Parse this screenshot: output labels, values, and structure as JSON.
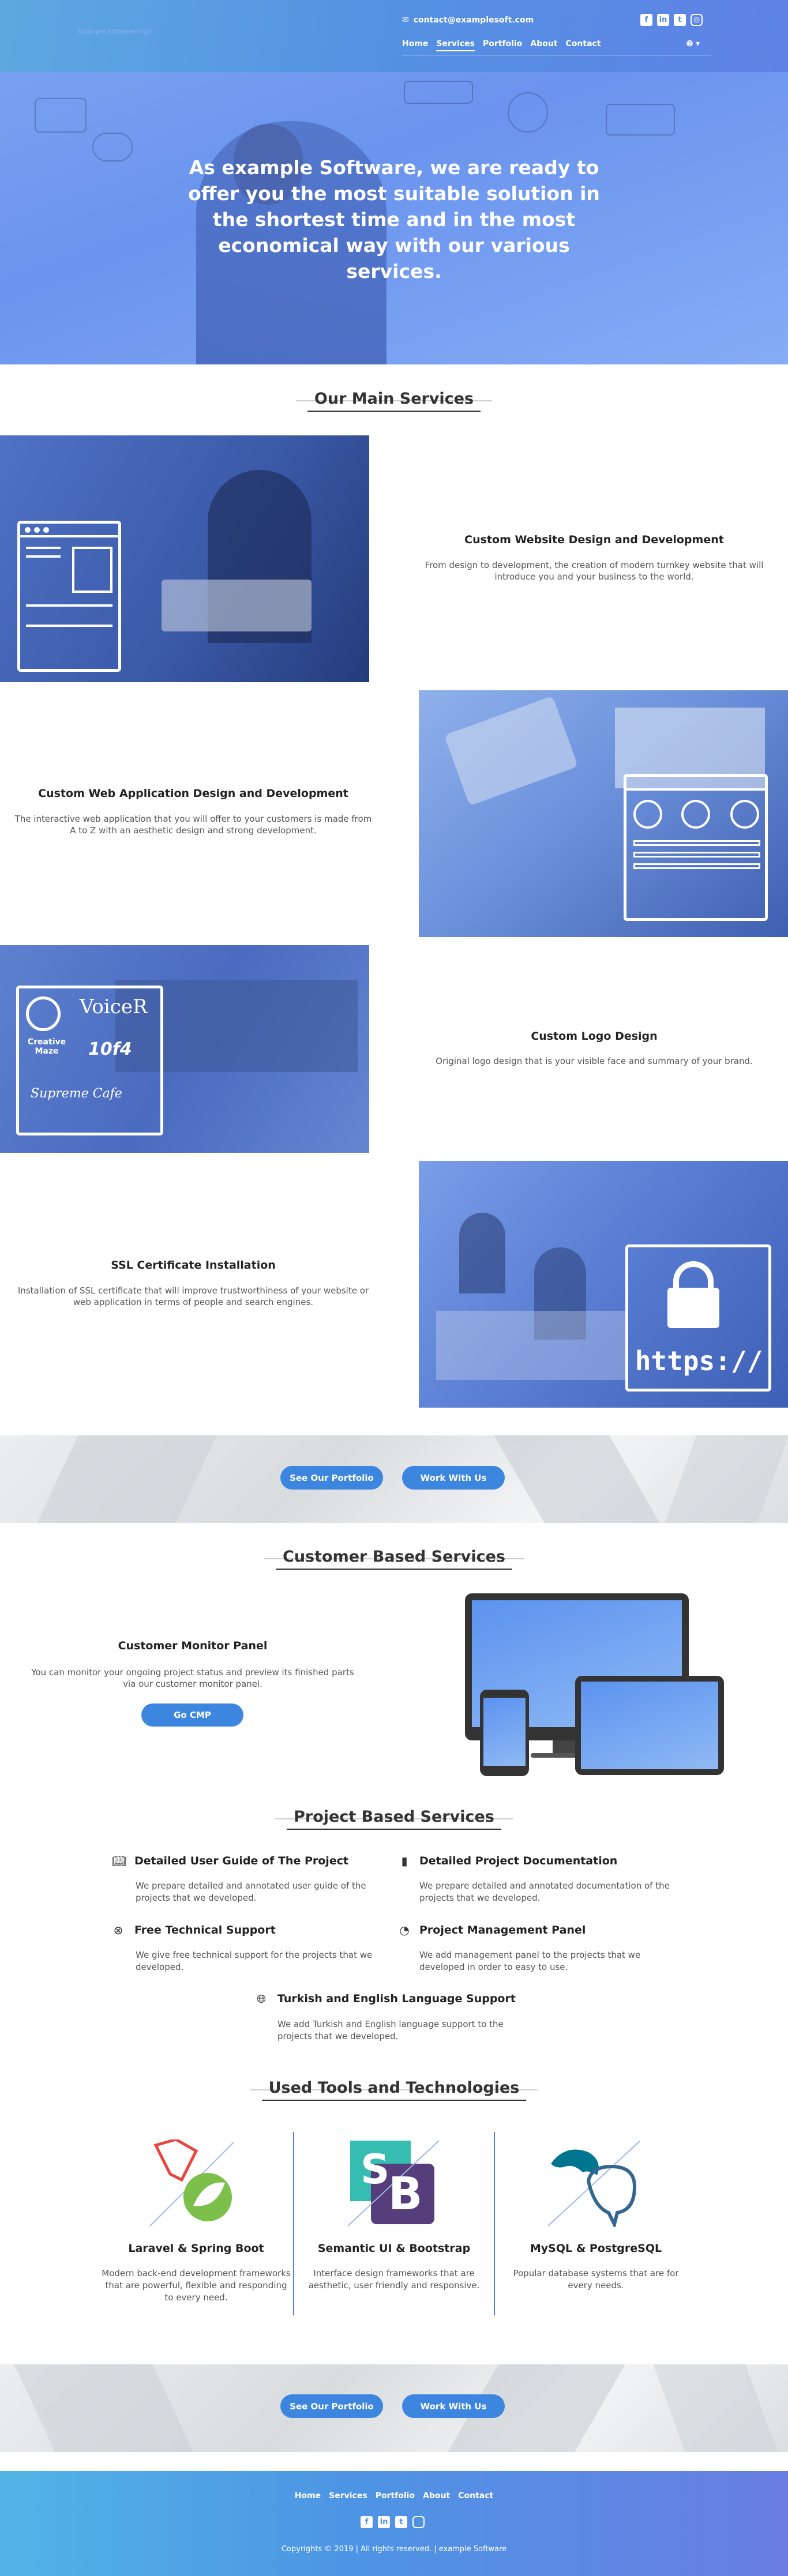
{
  "header": {
    "logo_alt": "Example Software logo",
    "email": "contact@examplesoft.com",
    "nav": [
      "Home",
      "Services",
      "Portfolio",
      "About",
      "Contact"
    ],
    "active_nav": "Services",
    "language_icon": "globe-icon",
    "social_icons": [
      "facebook-icon",
      "linkedin-icon",
      "twitter-icon",
      "instagram-icon"
    ]
  },
  "hero": {
    "title": "As example Software, we are ready to offer you the most suitable solution in the shortest time and in the most economical way with our various services."
  },
  "main_services": {
    "heading": "Our Main Services",
    "items": [
      {
        "title": "Custom Website Design and Development",
        "desc": "From design to development, the creation of modern turnkey website that will introduce you and your business to the world."
      },
      {
        "title": "Custom Web Application Design and Development",
        "desc": "The interactive web application that you will offer to your customers is made from A to Z with an aesthetic design and strong development."
      },
      {
        "title": "Custom Logo Design",
        "desc": "Original logo design that is your visible face and summary of your brand."
      },
      {
        "title": "SSL Certificate Installation",
        "desc": "Installation of SSL certificate that will improve trustworthiness of your website or web application in terms of people and search engines."
      }
    ],
    "logo_samples": {
      "voicer": "VoiceR",
      "creative": "Creative Maze",
      "fourteen": "10f4",
      "cafe": "Supreme Cafe"
    },
    "ssl_text": "https://"
  },
  "cta_band": {
    "portfolio_label": "See Our Portfolio",
    "work_label": "Work With Us"
  },
  "customer_services": {
    "heading": "Customer Based Services",
    "title": "Customer Monitor Panel",
    "desc": "You can monitor your ongoing project status and preview its finished parts via our customer monitor panel.",
    "button": "Go CMP"
  },
  "project_services": {
    "heading": "Project Based Services",
    "items": [
      {
        "icon": "book-icon",
        "title": "Detailed User Guide of The Project",
        "desc": "We prepare detailed and annotated user guide of the projects that we developed."
      },
      {
        "icon": "document-icon",
        "title": "Detailed Project Documentation",
        "desc": "We prepare detailed and annotated documentation of the projects that we developed."
      },
      {
        "icon": "lifebuoy-icon",
        "title": "Free Technical Support",
        "desc": "We give free technical support for the projects that we developed."
      },
      {
        "icon": "dashboard-icon",
        "title": "Project Management Panel",
        "desc": "We add management panel to the projects that we developed in order to easy to use."
      },
      {
        "icon": "globe-icon",
        "title": "Turkish and English Language Support",
        "desc": "We add Turkish and English language support to the projects that we developed."
      }
    ]
  },
  "tools": {
    "heading": "Used Tools and Technologies",
    "items": [
      {
        "title": "Laravel & Spring Boot",
        "desc": "Modern back-end development frameworks that are powerful, flexible and responding to every need."
      },
      {
        "title": "Semantic UI & Bootstrap",
        "desc": "Interface design frameworks that are aesthetic, user friendly and responsive."
      },
      {
        "title": "MySQL & PostgreSQL",
        "desc": "Popular database systems that are for every needs."
      }
    ],
    "semantic_letters": [
      "S",
      "B"
    ]
  },
  "footer": {
    "nav": [
      "Home",
      "Services",
      "Portfolio",
      "About",
      "Contact"
    ],
    "copyright": "Copyrights © 2019 | All rights reserved. | example Software"
  },
  "colors": {
    "accent": "#3d86e0",
    "footer_start": "#52b4e6",
    "footer_end": "#6a7ee4"
  }
}
